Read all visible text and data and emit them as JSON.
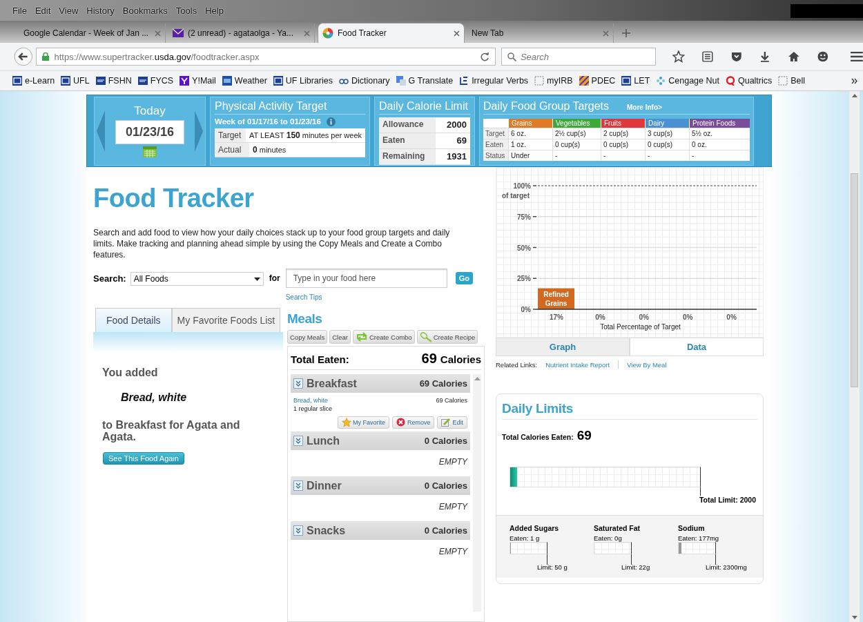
{
  "browser": {
    "menu": [
      "File",
      "Edit",
      "View",
      "History",
      "Bookmarks",
      "Tools",
      "Help"
    ],
    "tabs": [
      {
        "title": "Google Calendar - Week of Jan ...",
        "kind": "plain",
        "selected": false
      },
      {
        "title": "(2 unread) - agataolga - Ya...",
        "kind": "mail",
        "selected": false
      },
      {
        "title": "Food Tracker",
        "kind": "site",
        "selected": true
      },
      {
        "title": "New Tab",
        "kind": "plain",
        "selected": false
      }
    ],
    "url": {
      "prefix": "https://www.supertracker.",
      "domain": "usda.gov",
      "path": "/foodtracker.aspx"
    },
    "search_placeholder": "Search",
    "bookmarks": [
      {
        "label": "e-Learn",
        "kind": "navy"
      },
      {
        "label": "UFL",
        "kind": "navy"
      },
      {
        "label": "FSHN",
        "kind": "bar"
      },
      {
        "label": "FYCS",
        "kind": "bar"
      },
      {
        "label": "Y!Mail",
        "kind": "violet"
      },
      {
        "label": "Weather",
        "kind": "sky"
      },
      {
        "label": "UF Libraries",
        "kind": "navy"
      },
      {
        "label": "Dictionary",
        "kind": "rings"
      },
      {
        "label": "G Translate",
        "kind": "squares"
      },
      {
        "label": "Irregular Verbs",
        "kind": "bracket"
      },
      {
        "label": "myIRB",
        "kind": "blank"
      },
      {
        "label": "PDEC",
        "kind": "striped"
      },
      {
        "label": "LET",
        "kind": "navy"
      },
      {
        "label": "Cengage Nut",
        "kind": "dots"
      },
      {
        "label": "Qualtrics",
        "kind": "ring"
      },
      {
        "label": "Bell",
        "kind": "blank"
      }
    ]
  },
  "date_panel": {
    "label": "Today",
    "date": "01/23/16"
  },
  "physical_activity": {
    "title": "Physical Activity Target",
    "week": "Week of 01/17/16 to 01/23/16",
    "rows": [
      {
        "label": "Target",
        "value": "AT LEAST **150** minutes per week"
      },
      {
        "label": "Actual",
        "value": "**0**  minutes"
      }
    ]
  },
  "calorie_limit": {
    "title": "Daily Calorie Limit",
    "rows": [
      {
        "label": "Allowance",
        "value": "2000"
      },
      {
        "label": "Eaten",
        "value": "69"
      },
      {
        "label": "Remaining",
        "value": "1931"
      }
    ]
  },
  "food_groups": {
    "title": "Daily Food Group Targets",
    "more_link": "More Info>",
    "columns": [
      {
        "name": "Grains",
        "color": "#df7a26"
      },
      {
        "name": "Vegetables",
        "color": "#3ea83a"
      },
      {
        "name": "Fruits",
        "color": "#e2363f"
      },
      {
        "name": "Dairy",
        "color": "#4b90d2"
      },
      {
        "name": "Protein Foods",
        "color": "#7b4c9c"
      }
    ],
    "rows": [
      {
        "label": "Target",
        "cells": [
          "6 oz.",
          "2½ cup(s)",
          "2 cup(s)",
          "3 cup(s)",
          "5½ oz."
        ]
      },
      {
        "label": "Eaten",
        "cells": [
          "1 oz.",
          "0 cup(s)",
          "0 cup(s)",
          "0 cup(s)",
          "0 oz."
        ]
      },
      {
        "label": "Status",
        "cells": [
          "Under",
          "-",
          "-",
          "-",
          "-"
        ]
      }
    ]
  },
  "main": {
    "title": "Food Tracker",
    "description": "Search and add food to view how your daily choices stack up to your food group targets and daily limits. Make tracking and planning ahead simple by using the Copy Meals and Create a Combo features.",
    "search": {
      "label": "Search:",
      "category": "All Foods",
      "for_label": "for",
      "placeholder": "Type in your food here",
      "go": "Go",
      "tips": "Search Tips"
    }
  },
  "left_tabs": [
    {
      "label": "Food Details",
      "selected": true
    },
    {
      "label": "My Favorite Foods List",
      "selected": false
    }
  ],
  "food_details": {
    "intro": "You added",
    "food": "Bread, white",
    "outro": "to Breakfast for Agata and Agata.",
    "button": "See This Food Again"
  },
  "meals": {
    "title": "Meals",
    "actions": [
      {
        "label": "Copy Meals",
        "kind": "text"
      },
      {
        "label": "Clear",
        "kind": "text"
      },
      {
        "label": "Create Combo",
        "kind": "combo"
      },
      {
        "label": "Create Recipe",
        "kind": "recipe"
      }
    ],
    "total_label": "Total Eaten:",
    "total_number": "69",
    "total_unit": "Calories",
    "list": [
      {
        "name": "Breakfast",
        "calories": "69 Calories",
        "items": [
          {
            "name": "Bread, white",
            "amount": "1 regular slice",
            "calories": "69 Calories",
            "actions": [
              {
                "label": "My Favorite",
                "kind": "favorite"
              },
              {
                "label": "Remove",
                "kind": "remove"
              },
              {
                "label": "Edit",
                "kind": "edit"
              }
            ]
          }
        ]
      },
      {
        "name": "Lunch",
        "calories": "0 Calories",
        "empty_text": "EMPTY"
      },
      {
        "name": "Dinner",
        "calories": "0 Calories",
        "empty_text": "EMPTY"
      },
      {
        "name": "Snacks",
        "calories": "0 Calories",
        "empty_text": "EMPTY"
      }
    ]
  },
  "progress": {
    "chart_data": {
      "type": "bar",
      "grid": true,
      "ylabel": "of target",
      "xlabel": "Total Percentage of Target",
      "ylim": [
        0,
        100
      ],
      "yticks": [
        {
          "value": 0,
          "label": "0%"
        },
        {
          "value": 25,
          "label": "25%"
        },
        {
          "value": 50,
          "label": "50%"
        },
        {
          "value": 75,
          "label": "75%"
        },
        {
          "value": 100,
          "label": "100%"
        }
      ],
      "series": [
        {
          "name": "Refined Grains",
          "color": "#d2691e",
          "values": [
            17,
            0,
            0,
            0,
            0
          ]
        }
      ],
      "value_labels": [
        "17%",
        "0%",
        "0%",
        "0%",
        "0%"
      ]
    },
    "view_tabs": [
      {
        "label": "Graph",
        "selected": true
      },
      {
        "label": "Data",
        "selected": false
      }
    ],
    "related_label": "Related Links:",
    "related_links": [
      "Nutrient Intake Report",
      "View By Meal"
    ]
  },
  "daily_limits": {
    "title": "Daily Limits",
    "total_label": "Total Calories Eaten:",
    "total_value": "69",
    "level": 0.035,
    "limit_label": "Total Limit: 2000",
    "nutrients": [
      {
        "name": "Added Sugars",
        "eaten": "Eaten: 1 g",
        "level": 0.02,
        "limit": "Limit: 50 g"
      },
      {
        "name": "Saturated Fat",
        "eaten": "Eaten: 0g",
        "level": 0,
        "limit": "Limit: 22g"
      },
      {
        "name": "Sodium",
        "eaten": "Eaten: 177mg",
        "level": 0.077,
        "limit": "Limit: 2300mg"
      }
    ]
  }
}
